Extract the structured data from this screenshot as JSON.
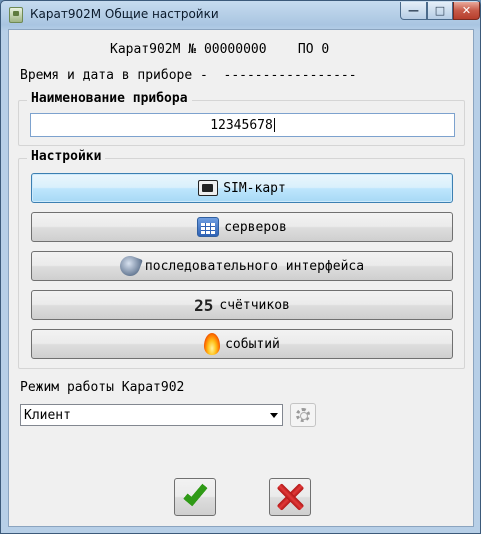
{
  "window": {
    "title": "Карат902М Общие настройки",
    "titlebar_buttons": {
      "minimize": "—",
      "maximize": "□",
      "close": "✕"
    }
  },
  "device": {
    "model": "Карат902М",
    "number_label": "№",
    "serial": "00000000",
    "fw_label": "ПО",
    "fw_version": "0",
    "time_label": "Время и дата в приборе -",
    "time_value": "-----------------"
  },
  "name_group": {
    "title": "Наименование прибора",
    "value": "12345678"
  },
  "settings_group": {
    "title": "Настройки",
    "buttons": [
      {
        "label": "SIM-карт",
        "icon": "sim-card-icon"
      },
      {
        "label": "серверов",
        "icon": "server-list-icon"
      },
      {
        "label": "последовательного интерфейса",
        "icon": "serial-plug-icon"
      },
      {
        "label": "счётчиков",
        "icon": "counter-icon",
        "icon_text": "25"
      },
      {
        "label": "событий",
        "icon": "fire-icon"
      }
    ]
  },
  "mode": {
    "label": "Режим работы Карат902",
    "selected": "Клиент"
  },
  "actions": {
    "ok_icon": "checkmark-icon",
    "cancel_icon": "cross-icon"
  },
  "colors": {
    "focus_border": "#3c7fb1",
    "ok_green": "#2f9a16",
    "cancel_red": "#e23a3a"
  }
}
